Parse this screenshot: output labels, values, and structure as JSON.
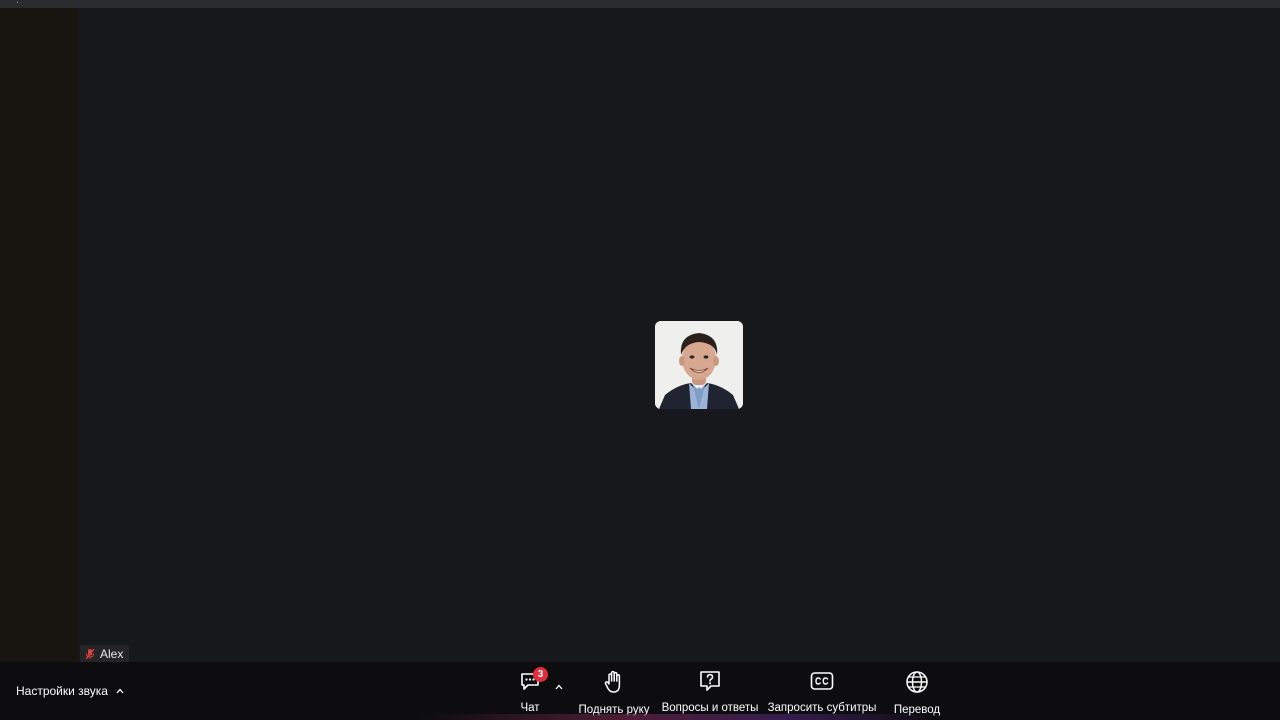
{
  "participant": {
    "name": "Alex",
    "muted": true
  },
  "toolbar": {
    "audio_settings_label": "Настройки звука",
    "chat_label": "Чат",
    "chat_unread": "3",
    "raise_hand_label": "Поднять руку",
    "qa_label": "Вопросы и ответы",
    "captions_label": "Запросить субтитры",
    "translate_label": "Перевод"
  },
  "colors": {
    "background": "#17181c",
    "toolbar": "#0d0d0f",
    "badge": "#e02d3c",
    "muted_icon": "#e0413f"
  }
}
